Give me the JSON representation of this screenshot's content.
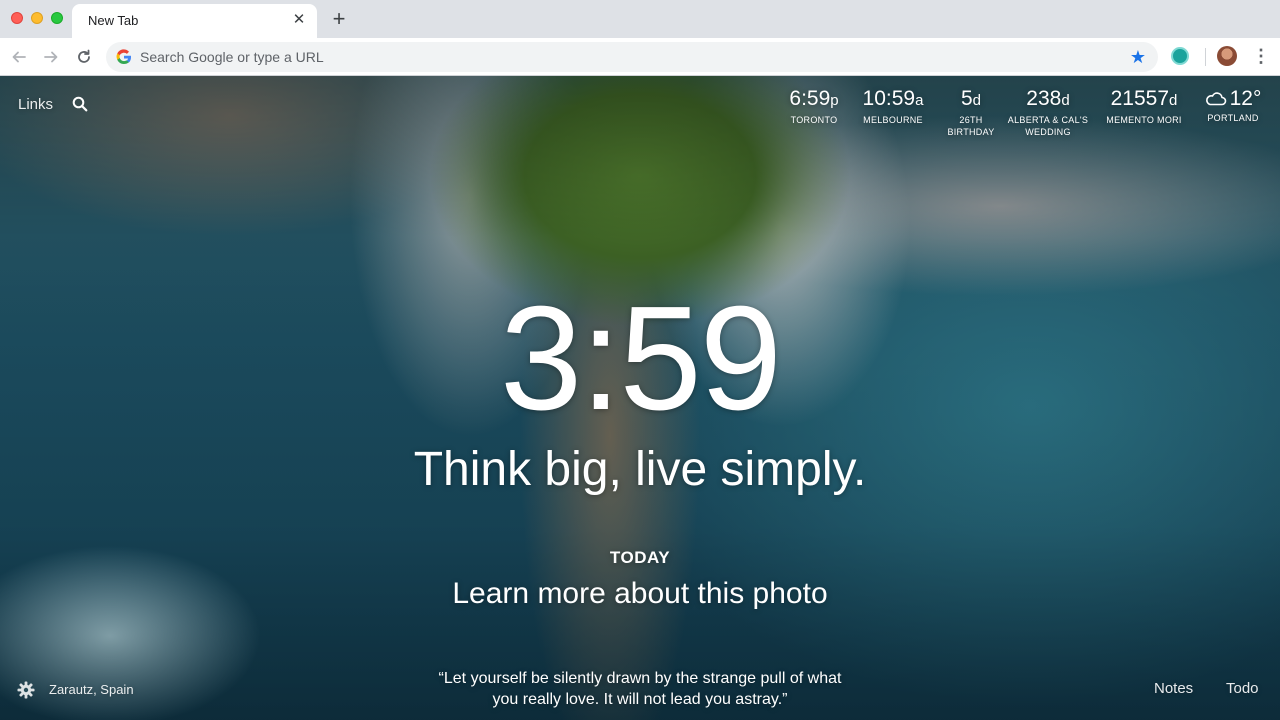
{
  "browser": {
    "tab_title": "New Tab",
    "close_glyph": "✕",
    "new_tab_glyph": "+",
    "omnibox_placeholder": "Search Google or type a URL",
    "bookmark_glyph": "★",
    "menu_glyph": "⋮",
    "accent_color": "#1a73e8"
  },
  "momentum": {
    "links_label": "Links",
    "metrics": [
      {
        "value": "6:59",
        "unit": "p",
        "label": "TORONTO"
      },
      {
        "value": "10:59",
        "unit": "a",
        "label": "MELBOURNE"
      },
      {
        "value": "5",
        "unit": "d",
        "label": "26TH",
        "label2": "BIRTHDAY"
      },
      {
        "value": "238",
        "unit": "d",
        "label": "ALBERTA & CAL'S",
        "label2": "WEDDING"
      },
      {
        "value": "21557",
        "unit": "d",
        "label": "MEMENTO MORI"
      },
      {
        "value": "12°",
        "unit": "",
        "label": "PORTLAND",
        "icon": "cloud-icon"
      }
    ],
    "clock": "3:59",
    "mantra": "Think big, live simply.",
    "today_label": "TODAY",
    "photo_link": "Learn more about this photo",
    "quote_line1": "“Let yourself be silently drawn by the strange pull of what",
    "quote_line2": "you really love. It will not lead you astray.”",
    "location": "Zarautz, Spain",
    "notes_label": "Notes",
    "todo_label": "Todo"
  }
}
